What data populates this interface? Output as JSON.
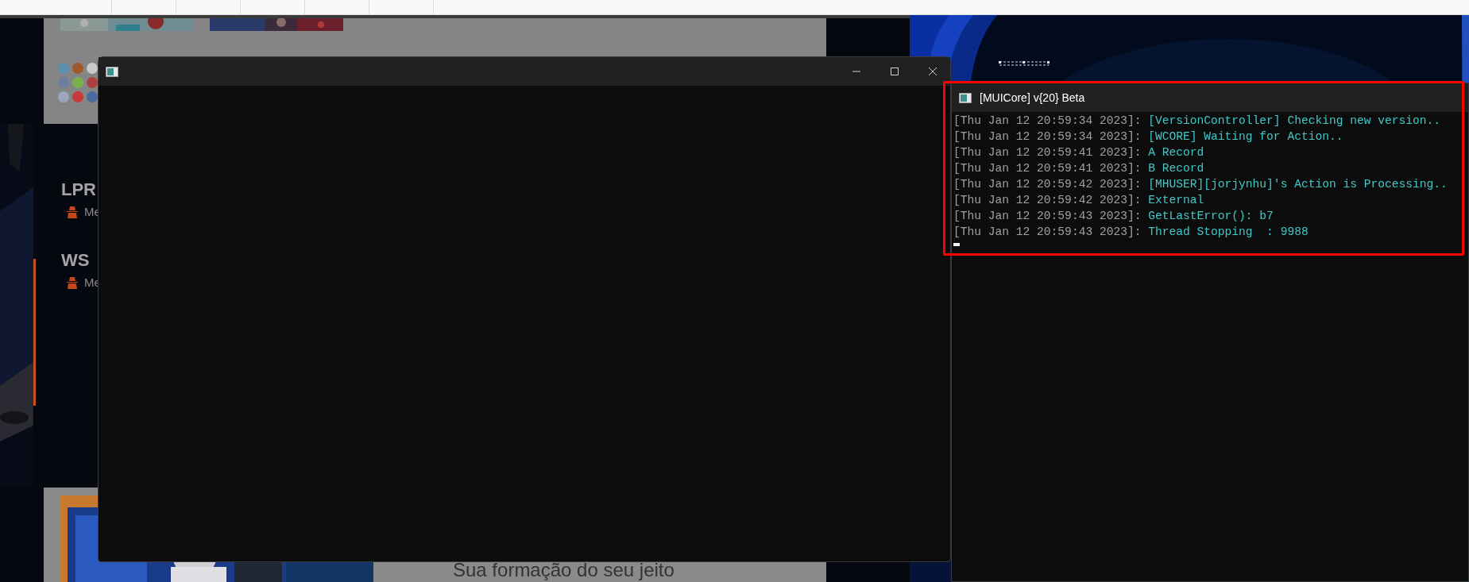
{
  "web_page": {
    "cards": [
      {
        "title": "LPR",
        "meta": "Me"
      },
      {
        "title": "WS",
        "meta": "Me"
      }
    ],
    "banner_text": "Sua formação do seu jeito"
  },
  "console_window": {
    "title": "[MUICore] v{20} Beta",
    "log": [
      {
        "time": "[Thu Jan 12 20:59:34 2023]:",
        "message": "[VersionController] Checking new version.."
      },
      {
        "time": "[Thu Jan 12 20:59:34 2023]:",
        "message": "[WCORE] Waiting for Action.."
      },
      {
        "time": "[Thu Jan 12 20:59:41 2023]:",
        "message": "A Record"
      },
      {
        "time": "[Thu Jan 12 20:59:41 2023]:",
        "message": "B Record"
      },
      {
        "time": "[Thu Jan 12 20:59:42 2023]:",
        "message": "[MHUSER][jorjynhu]'s Action is Processing.."
      },
      {
        "time": "[Thu Jan 12 20:59:42 2023]:",
        "message": "External"
      },
      {
        "time": "[Thu Jan 12 20:59:43 2023]:",
        "message": "GetLastError(): b7"
      },
      {
        "time": "[Thu Jan 12 20:59:43 2023]:",
        "message": "Thread Stopping  : 9988"
      }
    ]
  }
}
